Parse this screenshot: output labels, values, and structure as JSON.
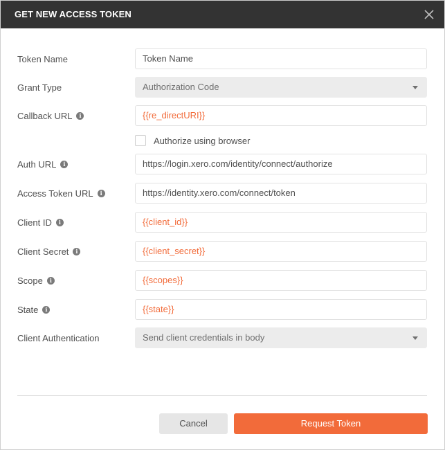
{
  "dialog": {
    "title": "GET NEW ACCESS TOKEN",
    "close_icon": "close-icon"
  },
  "fields": {
    "token_name": {
      "label": "Token Name",
      "placeholder": "Token Name",
      "value": ""
    },
    "grant_type": {
      "label": "Grant Type",
      "value": "Authorization Code"
    },
    "callback_url": {
      "label": "Callback URL",
      "value": "{{re_directURI}}"
    },
    "authorize_browser": {
      "label": "Authorize using browser",
      "checked": false
    },
    "auth_url": {
      "label": "Auth URL",
      "value": "https://login.xero.com/identity/connect/authorize"
    },
    "access_token_url": {
      "label": "Access Token URL",
      "value": "https://identity.xero.com/connect/token"
    },
    "client_id": {
      "label": "Client ID",
      "value": "{{client_id}}"
    },
    "client_secret": {
      "label": "Client Secret",
      "value": "{{client_secret}}"
    },
    "scope": {
      "label": "Scope",
      "value": "{{scopes}}"
    },
    "state": {
      "label": "State",
      "value": "{{state}}"
    },
    "client_authentication": {
      "label": "Client Authentication",
      "value": "Send client credentials in body"
    }
  },
  "buttons": {
    "cancel": "Cancel",
    "request_token": "Request Token"
  },
  "info_glyph": "i",
  "colors": {
    "titlebar": "#333333",
    "accent": "#f26b3a",
    "variable_text": "#f26b3a"
  }
}
